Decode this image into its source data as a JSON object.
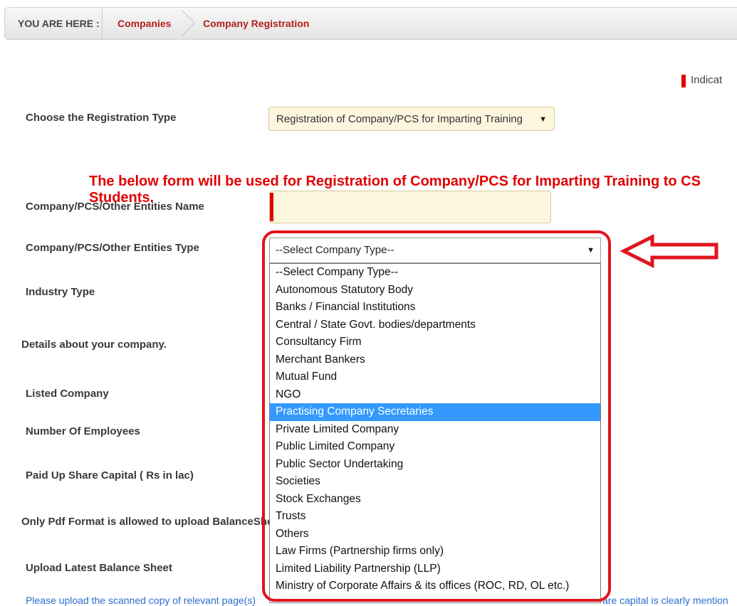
{
  "breadcrumb": {
    "prefix": "YOU ARE HERE :",
    "items": [
      "Companies",
      "Company Registration"
    ]
  },
  "indicator_text": "Indicat",
  "registration_type": {
    "label": "Choose the Registration Type",
    "selected": "Registration of Company/PCS for Imparting Training"
  },
  "notice": "The below form will be used for Registration of Company/PCS for Imparting Training to CS Students.",
  "fields": {
    "entity_name_label": "Company/PCS/Other Entities Name",
    "entity_name_value": "",
    "entity_type_label": "Company/PCS/Other Entities Type",
    "industry_type_label": "Industry Type",
    "details_label": "Details about your company.",
    "listed_label": "Listed Company",
    "employees_label": "Number Of Employees",
    "capital_label": "Paid Up Share Capital ( Rs in lac)",
    "pdf_note": "Only Pdf Format is allowed to upload BalanceSheet",
    "upload_label": "Upload Latest Balance Sheet"
  },
  "company_type_dropdown": {
    "selected": "--Select Company Type--",
    "highlighted_index": 8,
    "options": [
      "--Select Company Type--",
      "Autonomous Statutory Body",
      "Banks / Financial Institutions",
      "Central / State Govt. bodies/departments",
      "Consultancy Firm",
      "Merchant Bankers",
      "Mutual Fund",
      "NGO",
      "Practising Company Secretaries",
      "Private Limited Company",
      "Public Limited Company",
      "Public Sector Undertaking",
      "Societies",
      "Stock Exchanges",
      "Trusts",
      "Others",
      "Law Firms (Partnership firms only)",
      "Limited Liability Partnership (LLP)",
      "Ministry of Corporate Affairs & its offices (ROC, RD, OL etc.)"
    ]
  },
  "help_text": {
    "left": "Please upload the scanned copy of relevant page(s)",
    "right": "are capital is clearly mention"
  },
  "colors": {
    "accent_red": "#e00000",
    "selection_blue": "#3399ff",
    "field_bg": "#fdf6df"
  }
}
